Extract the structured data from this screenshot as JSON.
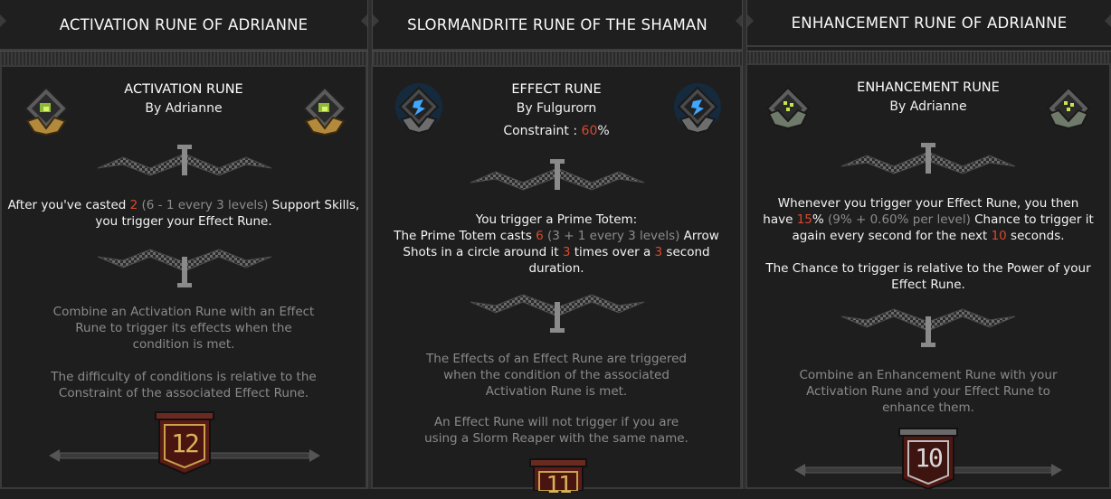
{
  "colors": {
    "accent_red": "#d9492f",
    "dim_text": "#8c8c8c",
    "gold": "#c9a24a",
    "blue": "#3fa7ff",
    "green": "#b8e04a"
  },
  "columns": [
    {
      "header": "ACTIVATION RUNE OF ADRIANNE",
      "type": "ACTIVATION RUNE",
      "author": "By Adrianne",
      "icon": "green-rune-icon",
      "desc": {
        "l1_a": "After you've casted ",
        "l1_v": "2",
        "l1_f": " (6 - 1 every 3 levels)",
        "l1_b": " Support Skills,",
        "l2": "you trigger your Effect Rune."
      },
      "lore1": [
        "Combine an Activation Rune with an Effect",
        "Rune to trigger its effects when the",
        "condition is met."
      ],
      "lore2": [
        "The difficulty of conditions is relative to the",
        "Constraint of the associated Effect Rune."
      ],
      "level": "12"
    },
    {
      "header": "SLORMANDRITE RUNE OF THE SHAMAN",
      "type": "EFFECT RUNE",
      "author": "By Fulgurorn",
      "constraint_label": "Constraint : ",
      "constraint_value": "60",
      "constraint_unit": "%",
      "icon": "blue-rune-icon",
      "desc": {
        "l1": "You trigger a Prime Totem:",
        "l2_a": "The Prime Totem casts ",
        "l2_v": "6",
        "l2_f": " (3 + 1 every 3 levels)",
        "l2_b": " Arrow",
        "l3_a": "Shots in a circle around it ",
        "l3_v": "3",
        "l3_b": " times over a ",
        "l3_v2": "3",
        "l3_c": " second",
        "l4": "duration."
      },
      "lore1": [
        "The Effects of an Effect Rune are triggered",
        "when the condition of the associated",
        "Activation Rune is met."
      ],
      "lore2": [
        "An Effect Rune will not trigger if you are",
        "using a Slorm Reaper with the same name."
      ],
      "level": "11"
    },
    {
      "header": "ENHANCEMENT RUNE OF ADRIANNE",
      "type": "ENHANCEMENT RUNE",
      "author": "By Adrianne",
      "icon": "teal-rune-icon",
      "desc": {
        "l1": "Whenever you trigger your Effect Rune, you then",
        "l2_a": "have ",
        "l2_v": "15",
        "l2_u": "%",
        "l2_f": " (9% + 0.60% per level)",
        "l2_b": " Chance to trigger it",
        "l3_a": "again every second for the next ",
        "l3_v": "10",
        "l3_b": " seconds.",
        "l4": "The Chance to trigger is relative to the Power of your",
        "l5": "Effect Rune."
      },
      "lore1": [
        "Combine an Enhancement Rune with your",
        "Activation Rune and your Effect Rune to",
        "enhance them."
      ],
      "level": "10"
    }
  ]
}
